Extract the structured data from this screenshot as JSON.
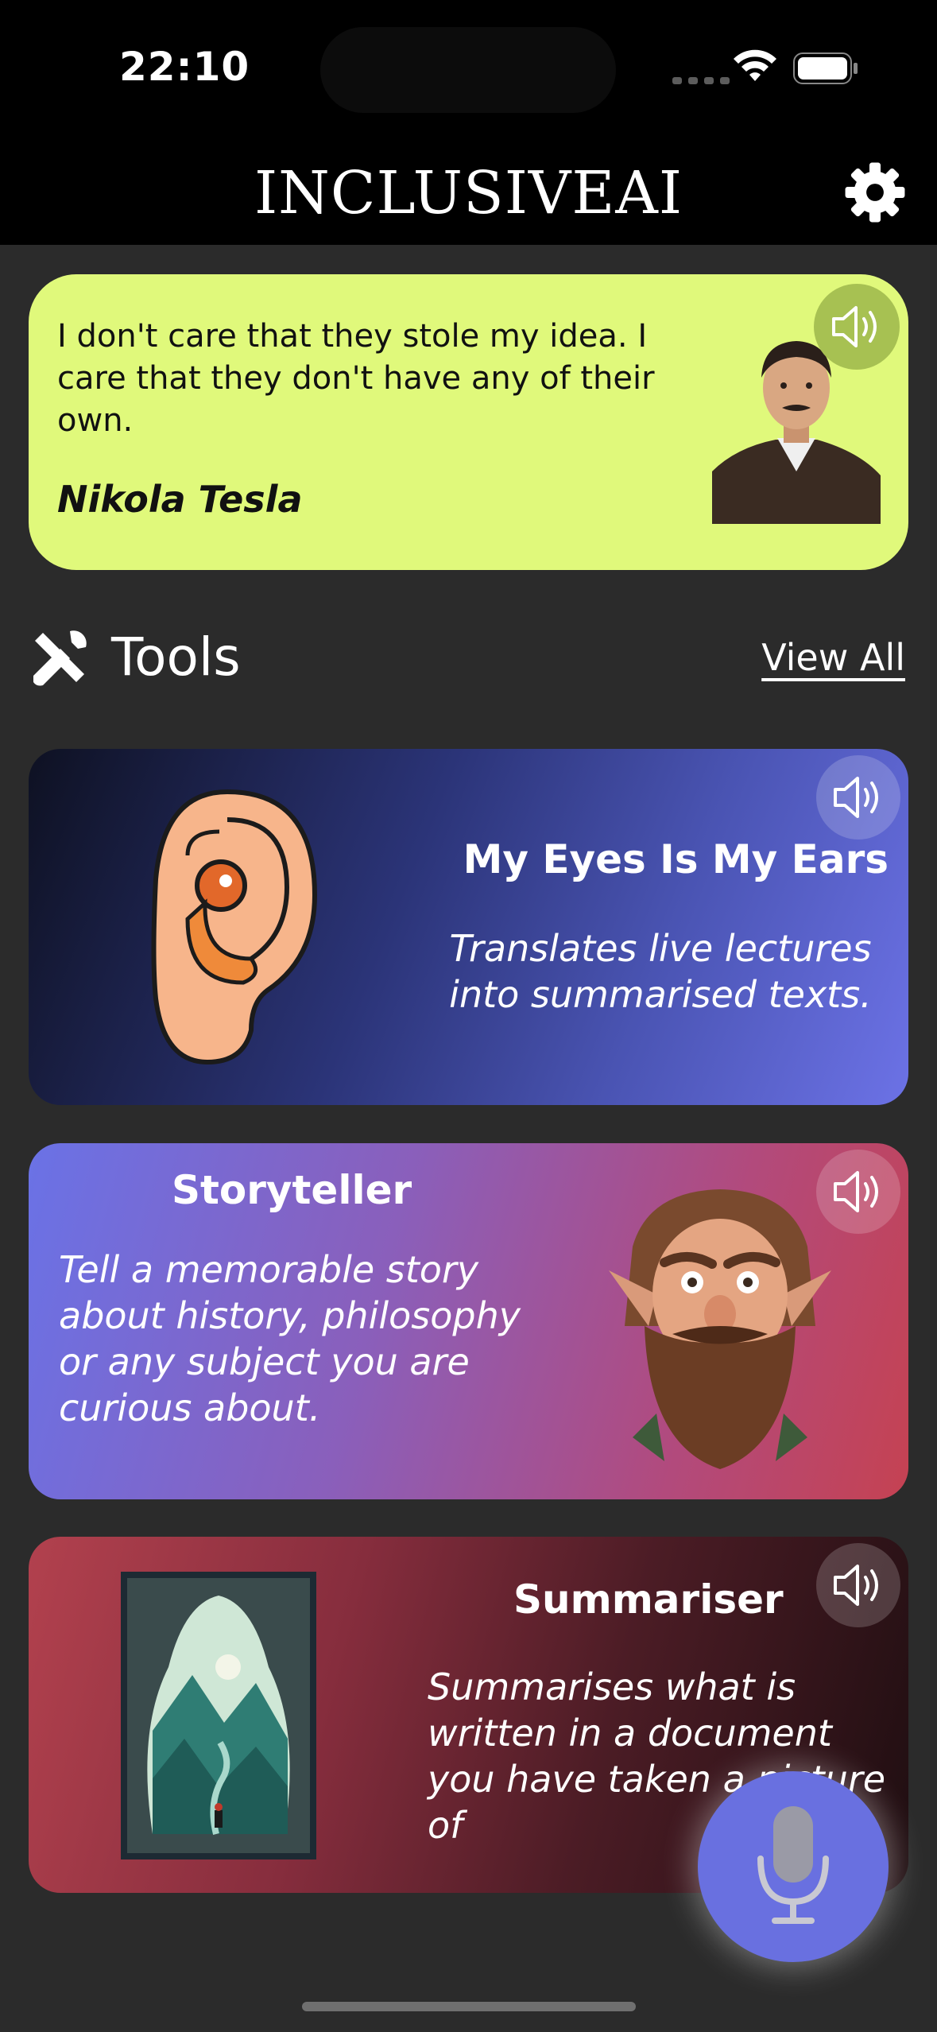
{
  "status_bar": {
    "time": "22:10"
  },
  "header": {
    "title": "INCLUSIVEAI",
    "settings_icon": "gear-icon"
  },
  "quote": {
    "text": "I don't care that they stole my idea. I care that they don't have any of their own.",
    "author": "Nikola Tesla",
    "background": "#e0f97b"
  },
  "tools": {
    "title": "Tools",
    "view_all": "View All",
    "icon": "tools-icon",
    "items": [
      {
        "title": "My Eyes Is My Ears",
        "description": "Translates live lectures into summarised texts.",
        "art": "ear-illustration"
      },
      {
        "title": "Storyteller",
        "description": "Tell a memorable story about history, philosophy or any subject you are curious about.",
        "art": "dwarf-illustration"
      },
      {
        "title": "Summariser",
        "description": "Summarises what is written in a document you have taken a picture of",
        "art": "landscape-book-illustration"
      }
    ]
  },
  "mic_button": {
    "icon": "microphone-icon",
    "color": "#6970e0"
  }
}
